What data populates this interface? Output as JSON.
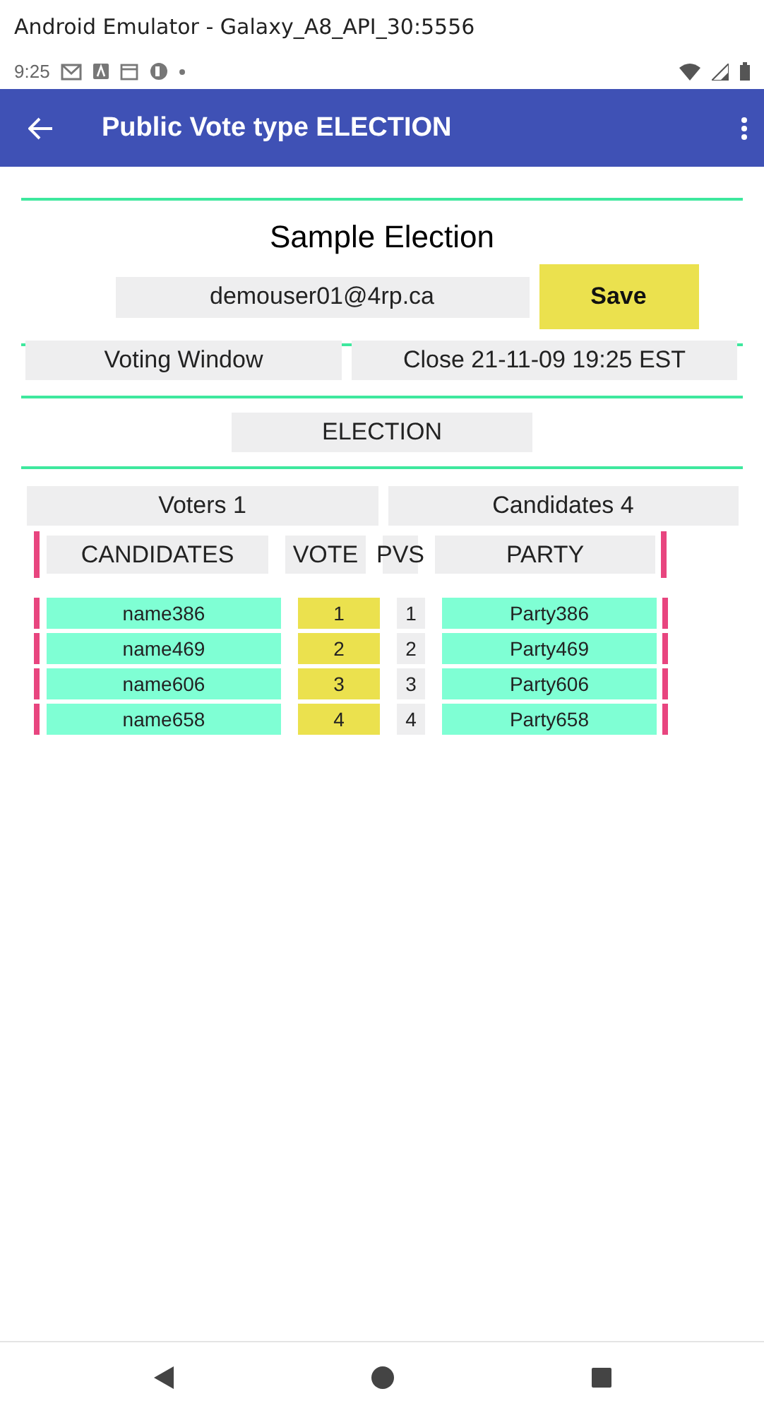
{
  "window": {
    "title": "Android Emulator - Galaxy_A8_API_30:5556"
  },
  "status_bar": {
    "time": "9:25"
  },
  "app_bar": {
    "title": "Public Vote type  ELECTION"
  },
  "election": {
    "title": "Sample Election",
    "email": "demouser01@4rp.ca",
    "save": "Save",
    "voting_window_label": "Voting Window",
    "close_time": "Close  21-11-09 19:25 EST",
    "type": "ELECTION",
    "voters": "Voters  1",
    "candidates_count": "Candidates  4"
  },
  "table": {
    "columns": [
      "CANDIDATES",
      "VOTE",
      "PVS",
      "PARTY"
    ],
    "rows": [
      {
        "candidate": "name386",
        "vote": "1",
        "pvs": "1",
        "party": "Party386"
      },
      {
        "candidate": "name469",
        "vote": "2",
        "pvs": "2",
        "party": "Party469"
      },
      {
        "candidate": "name606",
        "vote": "3",
        "pvs": "3",
        "party": "Party606"
      },
      {
        "candidate": "name658",
        "vote": "4",
        "pvs": "4",
        "party": "Party658"
      }
    ]
  }
}
